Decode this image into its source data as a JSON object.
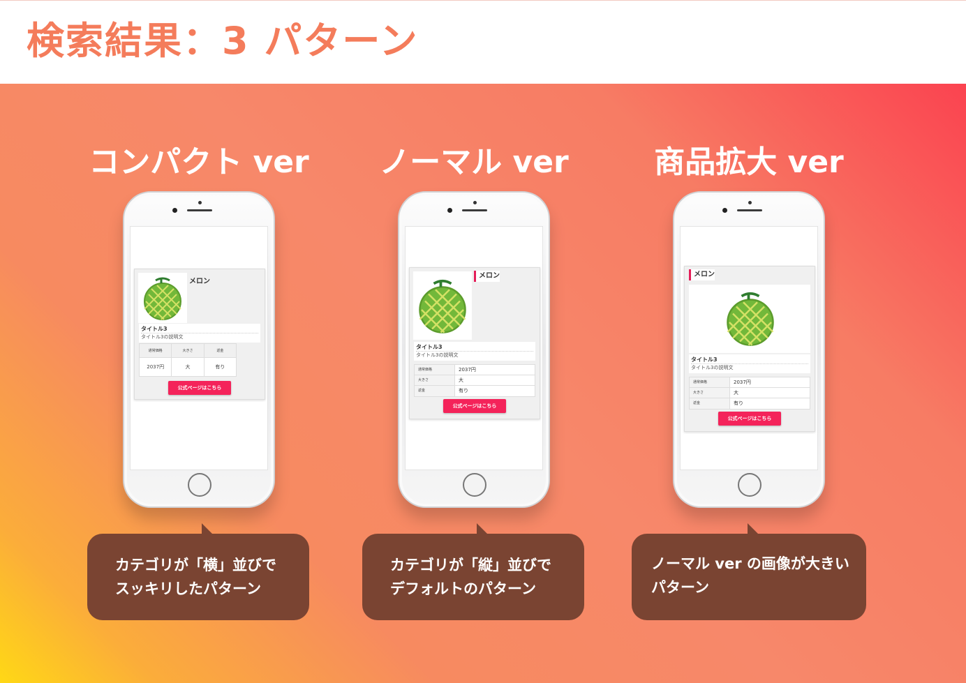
{
  "page": {
    "title": "検索結果：3 パターン"
  },
  "columns": [
    {
      "title": "コンパクト ver",
      "card": {
        "product_name": "メロン",
        "item_title": "タイトル3",
        "item_desc": "タイトル3の説明文",
        "spec_headers": [
          "通常価格",
          "大きさ",
          "返金"
        ],
        "spec_values": [
          "2037円",
          "大",
          "有り"
        ],
        "cta_label": "公式ページはこちら"
      },
      "caption": [
        "カテゴリが「横」並びで",
        "スッキリしたパターン"
      ]
    },
    {
      "title": "ノーマル ver",
      "card": {
        "product_name": "メロン",
        "item_title": "タイトル3",
        "item_desc": "タイトル3の説明文",
        "spec_rows": [
          {
            "key": "通常価格",
            "value": "2037円"
          },
          {
            "key": "大きさ",
            "value": "大"
          },
          {
            "key": "返金",
            "value": "有り"
          }
        ],
        "cta_label": "公式ページはこちら"
      },
      "caption": [
        "カテゴリが「縦」並びで",
        "デフォルトのパターン"
      ]
    },
    {
      "title": "商品拡大 ver",
      "card": {
        "product_name": "メロン",
        "item_title": "タイトル3",
        "item_desc": "タイトル3の説明文",
        "spec_rows": [
          {
            "key": "通常価格",
            "value": "2037円"
          },
          {
            "key": "大きさ",
            "value": "大"
          },
          {
            "key": "返金",
            "value": "有り"
          }
        ],
        "cta_label": "公式ページはこちら"
      },
      "caption": [
        "ノーマル ver の画像が大きい",
        "パターン"
      ]
    }
  ],
  "colors": {
    "accent": "#f47c5b",
    "cta": "#f4235a",
    "bubble": "#7a4432",
    "name_bar": "#e41e59"
  },
  "icons": [
    "melon-image",
    "home-button"
  ]
}
